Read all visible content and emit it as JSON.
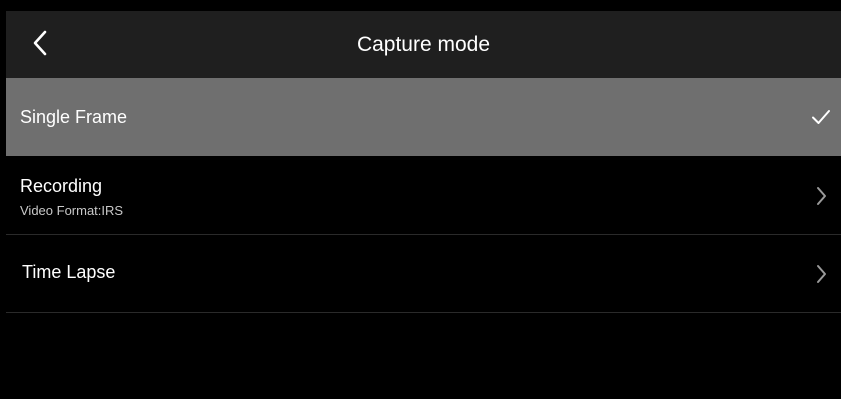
{
  "header": {
    "title": "Capture mode",
    "back_icon": "chevron-left-icon"
  },
  "menu": {
    "items": [
      {
        "label": "Single Frame",
        "sublabel": "",
        "selected": true,
        "trail_icon": "checkmark-icon"
      },
      {
        "label": "Recording",
        "sublabel": "Video Format:IRS",
        "selected": false,
        "trail_icon": "chevron-right-icon"
      },
      {
        "label": "Time Lapse",
        "sublabel": "",
        "selected": false,
        "trail_icon": "chevron-right-icon"
      }
    ]
  },
  "colors": {
    "background": "#000000",
    "header_background": "#1f1f1f",
    "selected_background": "#6f6f6f",
    "divider": "#2a2a2a",
    "text_primary": "#ffffff",
    "text_secondary": "#c8c8c8",
    "chevron": "#9a9a9a"
  }
}
